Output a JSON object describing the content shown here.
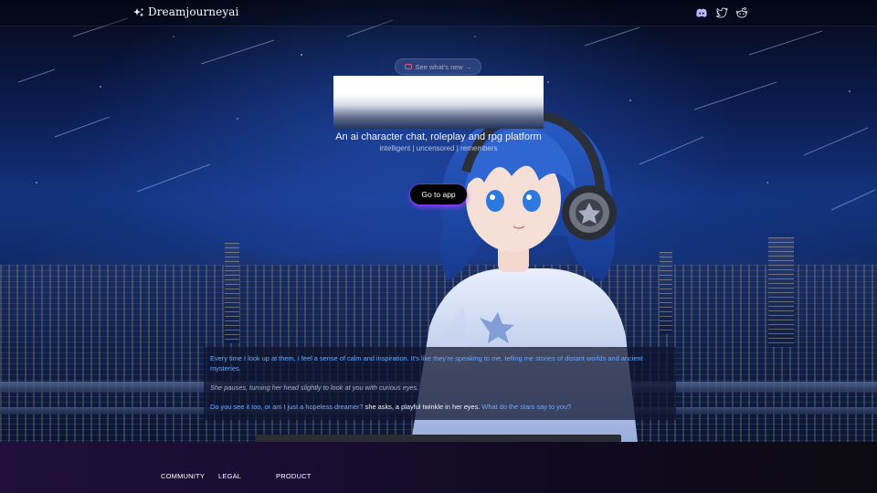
{
  "header": {
    "brand_name": "Dreamjourneyai",
    "social_icons": [
      "discord-icon",
      "twitter-icon",
      "reddit-icon"
    ]
  },
  "hero": {
    "announcement_label": "See what's new →",
    "tagline": "An ai character chat, roleplay and rpg platform",
    "subtagline": "intelligent | uncensored | remembers",
    "cta_label": "Go to app"
  },
  "dialog": {
    "line1": "Every time I look up at them, I feel a sense of calm and inspiration. It's like they're speaking to me, telling me stories of distant worlds and ancient mysteries.",
    "line2": "She pauses, turning her head slightly to look at you with curious eyes.",
    "line3_part1": "Do you see it too, or am I just a hopeless dreamer?",
    "line3_part2": " she asks, a playful twinkle in her eyes. ",
    "line3_part3": "What do the stars say to you?"
  },
  "footer": {
    "columns": [
      "COMMUNITY",
      "LEGAL",
      "PRODUCT"
    ]
  },
  "colors": {
    "accent_purple": "#9b3cff",
    "dialog_blue": "#6aa9ff",
    "sky_blue": "#14337f"
  }
}
